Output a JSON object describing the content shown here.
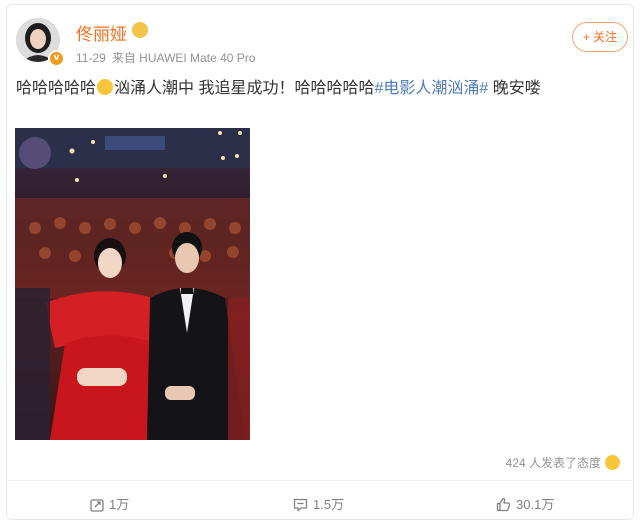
{
  "user": {
    "name": "佟丽娅",
    "date": "11-29",
    "source_prefix": "来自",
    "device": "HUAWEI Mate 40 Pro",
    "verify_symbol": "v"
  },
  "follow_button": "+ 关注",
  "post": {
    "text_before": "哈哈哈哈哈",
    "text_middle": "汹涌人潮中 我追星成功！哈哈哈哈哈",
    "hashtag": "#电影人潮汹涌#",
    "text_after": " 晚安喽"
  },
  "reactions_text": "424 人发表了态度",
  "actions": {
    "repost_count": "1万",
    "comment_count": "1.5万",
    "like_count": "30.1万"
  },
  "colors": {
    "username": "#f86e1d",
    "hashtag": "#4e7cc2",
    "meta": "#939393"
  },
  "icons": [
    "verified-badge-icon",
    "crown-icon",
    "emoji-icon",
    "laugh-icon",
    "repost-icon",
    "comment-icon",
    "like-icon"
  ]
}
